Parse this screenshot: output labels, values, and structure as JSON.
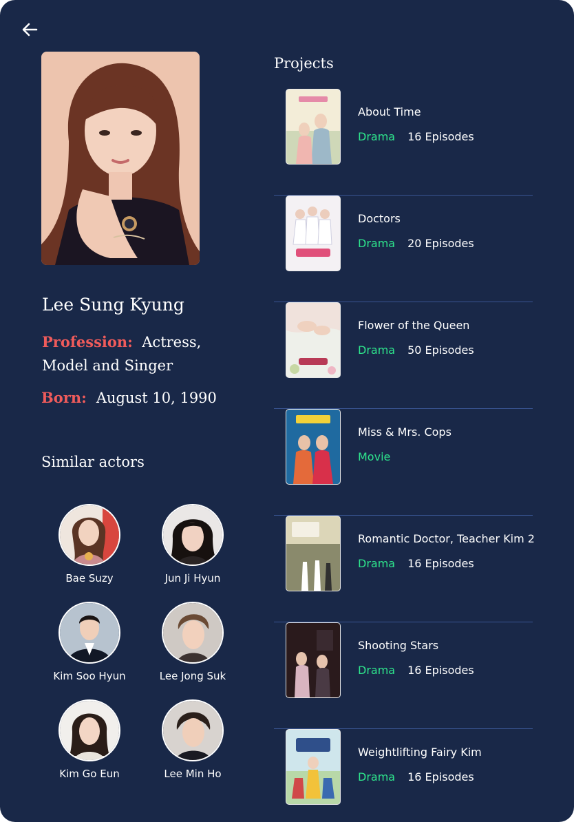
{
  "nav": {
    "back_icon": "arrow-left-icon"
  },
  "actor": {
    "name": "Lee Sung Kyung",
    "profession_label": "Profession:",
    "profession_value": "Actress, Model and Singer",
    "born_label": "Born:",
    "born_value": "August 10, 1990"
  },
  "similar": {
    "title": "Similar actors",
    "actors": [
      {
        "name": "Bae Suzy"
      },
      {
        "name": "Jun Ji Hyun"
      },
      {
        "name": "Kim Soo Hyun"
      },
      {
        "name": "Lee Jong Suk"
      },
      {
        "name": "Kim Go Eun"
      },
      {
        "name": "Lee Min Ho"
      }
    ]
  },
  "projects": {
    "title": "Projects",
    "items": [
      {
        "title": "About Time",
        "genre": "Drama",
        "episodes": "16 Episodes"
      },
      {
        "title": "Doctors",
        "genre": "Drama",
        "episodes": "20 Episodes"
      },
      {
        "title": "Flower of the Queen",
        "genre": "Drama",
        "episodes": "50 Episodes"
      },
      {
        "title": "Miss & Mrs. Cops",
        "genre": "Movie",
        "episodes": ""
      },
      {
        "title": "Romantic Doctor, Teacher Kim 2",
        "genre": "Drama",
        "episodes": "16 Episodes"
      },
      {
        "title": "Shooting Stars",
        "genre": "Drama",
        "episodes": "16 Episodes"
      },
      {
        "title": "Weightlifting Fairy Kim",
        "genre": "Drama",
        "episodes": "16 Episodes"
      }
    ]
  },
  "colors": {
    "background": "#192848",
    "accent_label": "#ef5b5b",
    "genre": "#2ee58c",
    "divider": "#3a5694"
  }
}
